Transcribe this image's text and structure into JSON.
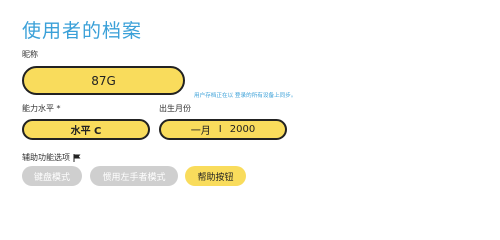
{
  "page": {
    "title": "使用者的档案"
  },
  "nickname": {
    "label": "昵称",
    "value": "87G",
    "hint": "用户存档正在以 登录的所有设备上同步。"
  },
  "level": {
    "label": "能力水平 *",
    "value": "水平 C"
  },
  "birth": {
    "label": "出生月份",
    "month": "一月",
    "separator": "I",
    "year": "2000"
  },
  "assist": {
    "label": "辅助功能选项",
    "flag_icon": "flag-icon",
    "options": [
      {
        "label": "键盘模式",
        "state": "off"
      },
      {
        "label": "惯用左手者模式",
        "state": "off"
      },
      {
        "label": "帮助按钮",
        "state": "on"
      }
    ]
  },
  "colors": {
    "accent_blue": "#3aa0d8",
    "pill_yellow": "#f9dc5c",
    "toggle_off": "#cfcfcf",
    "border": "#222222"
  }
}
